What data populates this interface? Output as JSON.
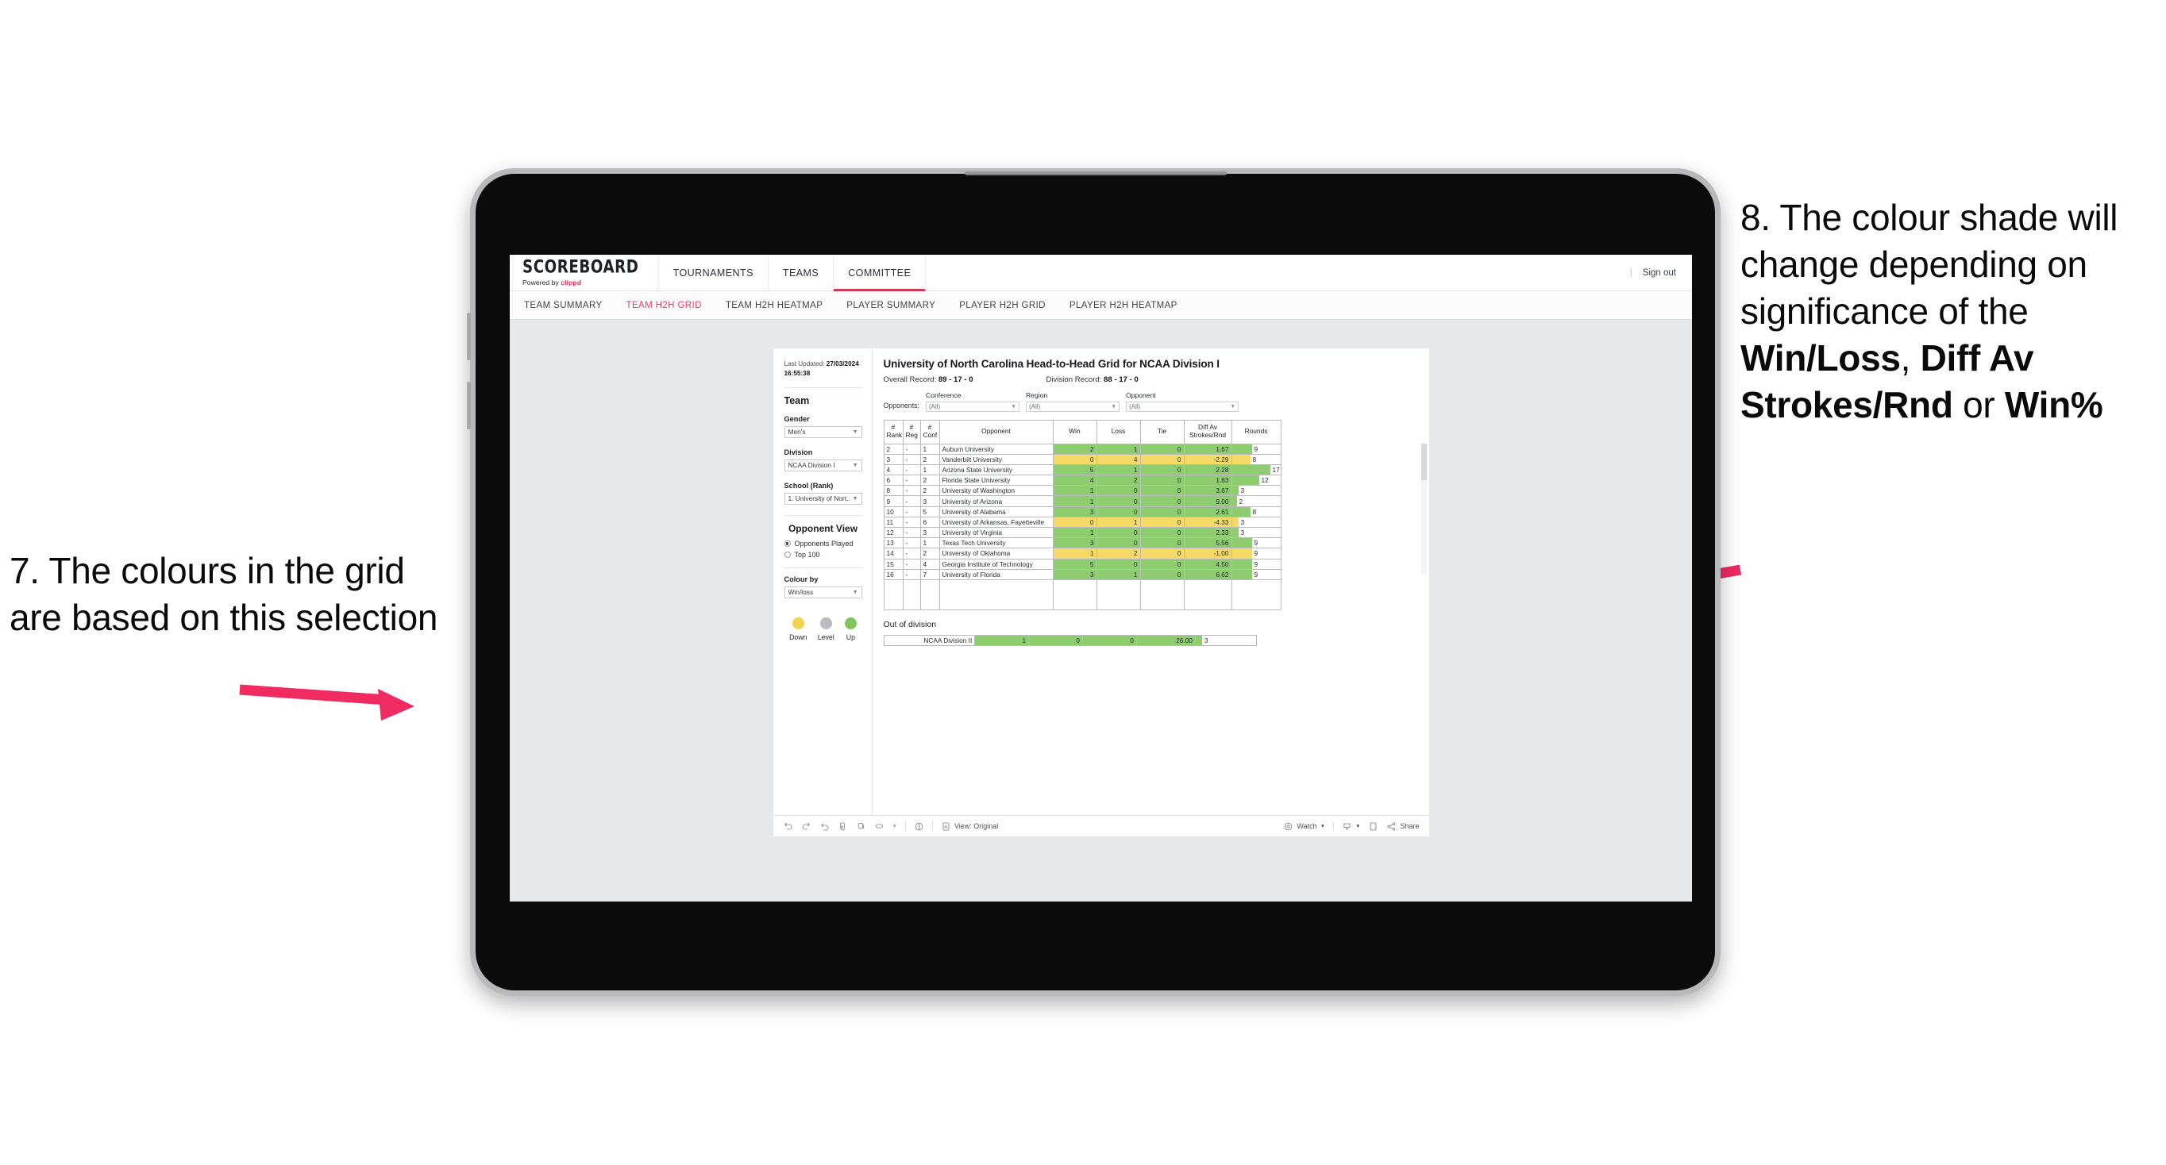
{
  "annotations": {
    "left": {
      "id": "7.",
      "text": "7. The colours in the grid are based on this selection"
    },
    "right": {
      "pre": "8. The colour shade will change depending on significance of the ",
      "b1": "Win/Loss",
      "mid1": ", ",
      "b2": "Diff Av Strokes/Rnd",
      "mid2": " or ",
      "b3": "Win%"
    },
    "arrow_color": "#ef2b62"
  },
  "app": {
    "brand": {
      "title": "SCOREBOARD",
      "powered_prefix": "Powered by ",
      "powered_brand": "clippd"
    },
    "mainnav": [
      {
        "label": "TOURNAMENTS",
        "active": false
      },
      {
        "label": "TEAMS",
        "active": false
      },
      {
        "label": "COMMITTEE",
        "active": true
      }
    ],
    "signout": {
      "divider": "|",
      "label": "Sign out"
    },
    "subnav": [
      {
        "label": "TEAM SUMMARY",
        "active": false
      },
      {
        "label": "TEAM H2H GRID",
        "active": true
      },
      {
        "label": "TEAM H2H HEATMAP",
        "active": false
      },
      {
        "label": "PLAYER SUMMARY",
        "active": false
      },
      {
        "label": "PLAYER H2H GRID",
        "active": false
      },
      {
        "label": "PLAYER H2H HEATMAP",
        "active": false
      }
    ]
  },
  "sidebar": {
    "last_updated_label": "Last Updated: ",
    "last_updated_value": "27/03/2024 16:55:38",
    "team_heading": "Team",
    "fields": [
      {
        "label": "Gender",
        "value": "Men's"
      },
      {
        "label": "Division",
        "value": "NCAA Division I"
      },
      {
        "label": "School (Rank)",
        "value": "1. University of Nort..."
      }
    ],
    "opponent_view_heading": "Opponent View",
    "opponent_view_options": [
      {
        "label": "Opponents Played",
        "selected": true
      },
      {
        "label": "Top 100",
        "selected": false
      }
    ],
    "colour_by_label": "Colour by",
    "colour_by_value": "Win/loss",
    "legend": [
      {
        "label": "Down",
        "color": "#f2d34f"
      },
      {
        "label": "Level",
        "color": "#b9bcc0"
      },
      {
        "label": "Up",
        "color": "#7fc45f"
      }
    ]
  },
  "main": {
    "title": "University of North Carolina Head-to-Head Grid for NCAA Division I",
    "overall_record_label": "Overall Record: ",
    "overall_record_value": "89 - 17 - 0",
    "division_record_label": "Division Record: ",
    "division_record_value": "88 - 17 - 0",
    "opponents_label": "Opponents:",
    "filters": [
      {
        "label": "Conference",
        "value": "(All)"
      },
      {
        "label": "Region",
        "value": "(All)"
      },
      {
        "label": "Opponent",
        "value": "(All)"
      }
    ],
    "columns": [
      "# Rank",
      "# Reg",
      "# Conf",
      "Opponent",
      "Win",
      "Loss",
      "Tie",
      "Diff Av Strokes/Rnd",
      "Rounds"
    ],
    "columns_split": [
      {
        "l1": "#",
        "l2": "Rank"
      },
      {
        "l1": "#",
        "l2": "Reg"
      },
      {
        "l1": "#",
        "l2": "Conf"
      },
      {
        "l1": "Opponent",
        "l2": ""
      },
      {
        "l1": "Win",
        "l2": ""
      },
      {
        "l1": "Loss",
        "l2": ""
      },
      {
        "l1": "Tie",
        "l2": ""
      },
      {
        "l1": "Diff Av",
        "l2": "Strokes/Rnd"
      },
      {
        "l1": "Rounds",
        "l2": ""
      }
    ],
    "rows": [
      {
        "rank": "2",
        "reg": "-",
        "conf": "1",
        "opponent": "Auburn University",
        "win": "2",
        "loss": "1",
        "tie": "0",
        "diff": "1.67",
        "rounds": "9",
        "color": "up"
      },
      {
        "rank": "3",
        "reg": "-",
        "conf": "2",
        "opponent": "Vanderbilt University",
        "win": "0",
        "loss": "4",
        "tie": "0",
        "diff": "-2.29",
        "rounds": "8",
        "color": "down"
      },
      {
        "rank": "4",
        "reg": "-",
        "conf": "1",
        "opponent": "Arizona State University",
        "win": "5",
        "loss": "1",
        "tie": "0",
        "diff": "2.28",
        "rounds": "17",
        "color": "up"
      },
      {
        "rank": "6",
        "reg": "-",
        "conf": "2",
        "opponent": "Florida State University",
        "win": "4",
        "loss": "2",
        "tie": "0",
        "diff": "1.83",
        "rounds": "12",
        "color": "up"
      },
      {
        "rank": "8",
        "reg": "-",
        "conf": "2",
        "opponent": "University of Washington",
        "win": "1",
        "loss": "0",
        "tie": "0",
        "diff": "3.67",
        "rounds": "3",
        "color": "up"
      },
      {
        "rank": "9",
        "reg": "-",
        "conf": "3",
        "opponent": "University of Arizona",
        "win": "1",
        "loss": "0",
        "tie": "0",
        "diff": "9.00",
        "rounds": "2",
        "color": "up"
      },
      {
        "rank": "10",
        "reg": "-",
        "conf": "5",
        "opponent": "University of Alabama",
        "win": "3",
        "loss": "0",
        "tie": "0",
        "diff": "2.61",
        "rounds": "8",
        "color": "up"
      },
      {
        "rank": "11",
        "reg": "-",
        "conf": "6",
        "opponent": "University of Arkansas, Fayetteville",
        "win": "0",
        "loss": "1",
        "tie": "0",
        "diff": "-4.33",
        "rounds": "3",
        "color": "down"
      },
      {
        "rank": "12",
        "reg": "-",
        "conf": "3",
        "opponent": "University of Virginia",
        "win": "1",
        "loss": "0",
        "tie": "0",
        "diff": "2.33",
        "rounds": "3",
        "color": "up"
      },
      {
        "rank": "13",
        "reg": "-",
        "conf": "1",
        "opponent": "Texas Tech University",
        "win": "3",
        "loss": "0",
        "tie": "0",
        "diff": "5.56",
        "rounds": "9",
        "color": "up"
      },
      {
        "rank": "14",
        "reg": "-",
        "conf": "2",
        "opponent": "University of Oklahoma",
        "win": "1",
        "loss": "2",
        "tie": "0",
        "diff": "-1.00",
        "rounds": "9",
        "color": "down"
      },
      {
        "rank": "15",
        "reg": "-",
        "conf": "4",
        "opponent": "Georgia Institute of Technology",
        "win": "5",
        "loss": "0",
        "tie": "0",
        "diff": "4.50",
        "rounds": "9",
        "color": "up"
      },
      {
        "rank": "16",
        "reg": "-",
        "conf": "7",
        "opponent": "University of Florida",
        "win": "3",
        "loss": "1",
        "tie": "0",
        "diff": "6.62",
        "rounds": "9",
        "color": "up"
      }
    ],
    "out_of_division_title": "Out of division",
    "out_of_division_row": {
      "label": "NCAA Division II",
      "win": "1",
      "loss": "0",
      "tie": "0",
      "diff": "26.00",
      "rounds": "3",
      "color": "up"
    },
    "colors": {
      "up": "#8ecc70",
      "down": "#f5da68",
      "level": "#b9bcc0"
    }
  },
  "viz_footer": {
    "view_label": "View: Original",
    "watch_label": "Watch",
    "share_label": "Share",
    "icons": [
      "undo-icon",
      "redo-icon",
      "revert-icon",
      "refresh-icon",
      "pause-icon",
      "highlight-icon",
      "caret-down-icon",
      "help-icon",
      "view-icon",
      "watch-icon",
      "download-icon",
      "fullscreen-icon",
      "share-icon"
    ]
  }
}
